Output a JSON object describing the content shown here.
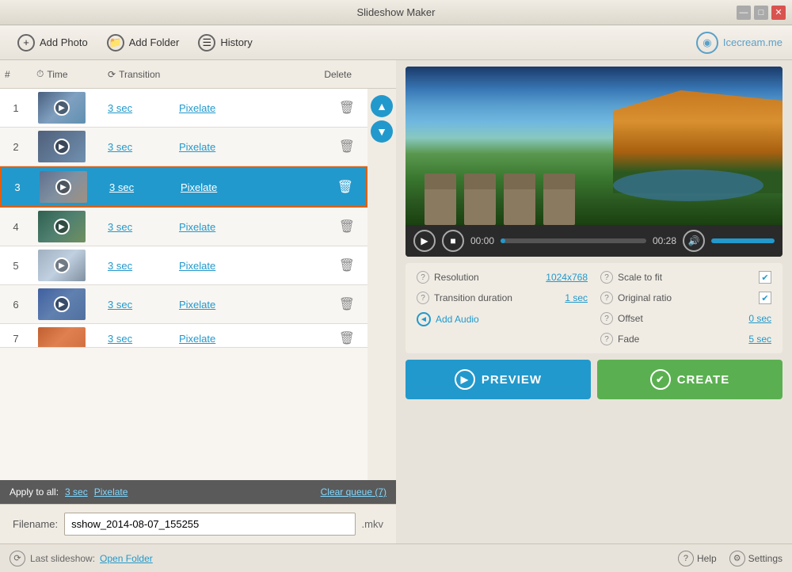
{
  "window": {
    "title": "Slideshow Maker",
    "min_label": "—",
    "max_label": "□",
    "close_label": "✕"
  },
  "toolbar": {
    "add_photo": "Add Photo",
    "add_folder": "Add Folder",
    "history": "History",
    "icecream": "Icecream.me"
  },
  "table": {
    "col_num": "#",
    "col_time": "Time",
    "col_transition": "Transition",
    "col_delete": "Delete"
  },
  "rows": [
    {
      "num": "1",
      "time": "3 sec",
      "transition": "Pixelate",
      "selected": false,
      "thumb_class": "thumb-1"
    },
    {
      "num": "2",
      "time": "3 sec",
      "transition": "Pixelate",
      "selected": false,
      "thumb_class": "thumb-2"
    },
    {
      "num": "3",
      "time": "3 sec",
      "transition": "Pixelate",
      "selected": true,
      "thumb_class": "thumb-3"
    },
    {
      "num": "4",
      "time": "3 sec",
      "transition": "Pixelate",
      "selected": false,
      "thumb_class": "thumb-4"
    },
    {
      "num": "5",
      "time": "3 sec",
      "transition": "Pixelate",
      "selected": false,
      "thumb_class": "thumb-5"
    },
    {
      "num": "6",
      "time": "3 sec",
      "transition": "Pixelate",
      "selected": false,
      "thumb_class": "thumb-6"
    },
    {
      "num": "7",
      "time": "3 sec",
      "transition": "Pixelate",
      "selected": false,
      "thumb_class": "thumb-7"
    }
  ],
  "apply_bar": {
    "label": "Apply to all:",
    "time": "3 sec",
    "transition": "Pixelate",
    "clear_queue": "Clear queue (7)"
  },
  "filename": {
    "label": "Filename:",
    "value": "sshow_2014-08-07_155255",
    "ext": ".mkv"
  },
  "footer": {
    "last_slideshow": "Last slideshow:",
    "open_folder": "Open Folder",
    "help": "Help",
    "settings": "Settings"
  },
  "video": {
    "time_current": "00:00",
    "time_total": "00:28"
  },
  "settings": {
    "resolution_label": "Resolution",
    "resolution_value": "1024x768",
    "transition_duration_label": "Transition duration",
    "transition_duration_value": "1 sec",
    "add_audio_label": "Add Audio",
    "scale_to_fit_label": "Scale to fit",
    "original_ratio_label": "Original ratio",
    "offset_label": "Offset",
    "offset_value": "0 sec",
    "fade_label": "Fade",
    "fade_value": "5 sec"
  },
  "buttons": {
    "preview": "PREVIEW",
    "create": "CREATE"
  }
}
